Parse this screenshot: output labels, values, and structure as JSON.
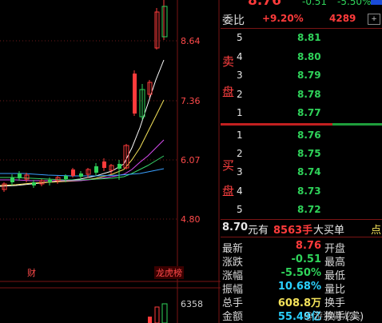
{
  "chart": {
    "price_axis": [
      "8.64",
      "7.36",
      "6.07",
      "4.80"
    ],
    "volume_axis": "6358",
    "bottom_tags": [
      "财",
      "龙虎榜"
    ]
  },
  "header": {
    "price_partial": "8.76",
    "change_partial": "-0.51",
    "change_pct_partial": "-5.50%",
    "committee_label": "委比",
    "committee_pct": "+9.20%",
    "committee_diff": "4289"
  },
  "sell_side_label": [
    "卖",
    "盘"
  ],
  "buy_side_label": [
    "买",
    "盘"
  ],
  "sell_orders": [
    {
      "level": "5",
      "price": "8.81"
    },
    {
      "level": "4",
      "price": "8.80"
    },
    {
      "level": "3",
      "price": "8.79"
    },
    {
      "level": "2",
      "price": "8.78"
    },
    {
      "level": "1",
      "price": "8.77"
    }
  ],
  "buy_orders": [
    {
      "level": "1",
      "price": "8.76"
    },
    {
      "level": "2",
      "price": "8.75"
    },
    {
      "level": "3",
      "price": "8.74"
    },
    {
      "level": "4",
      "price": "8.73"
    },
    {
      "level": "5",
      "price": "8.72"
    }
  ],
  "big_order": {
    "price": "8.70",
    "text": "元有",
    "amount": "8563手",
    "type": "大买单",
    "suffix": "点"
  },
  "stats": [
    {
      "label": "最新",
      "value": "8.76",
      "label2": "开盘",
      "color": "red"
    },
    {
      "label": "涨跌",
      "value": "-0.51",
      "label2": "最高",
      "color": "green"
    },
    {
      "label": "涨幅",
      "value": "-5.50%",
      "label2": "最低",
      "color": "green"
    },
    {
      "label": "振幅",
      "value": "10.68%",
      "label2": "量比",
      "color": "cyan"
    },
    {
      "label": "总手",
      "value": "608.8万",
      "label2": "换手",
      "color": "yellow"
    },
    {
      "label": "金额",
      "value": "55.49亿",
      "label2": "换手(实)",
      "color": "cyan"
    }
  ],
  "watermark": "@游资做龙头",
  "colors": {
    "up": "#ff3b3b",
    "down": "#2fd35a",
    "bg": "#000000"
  }
}
